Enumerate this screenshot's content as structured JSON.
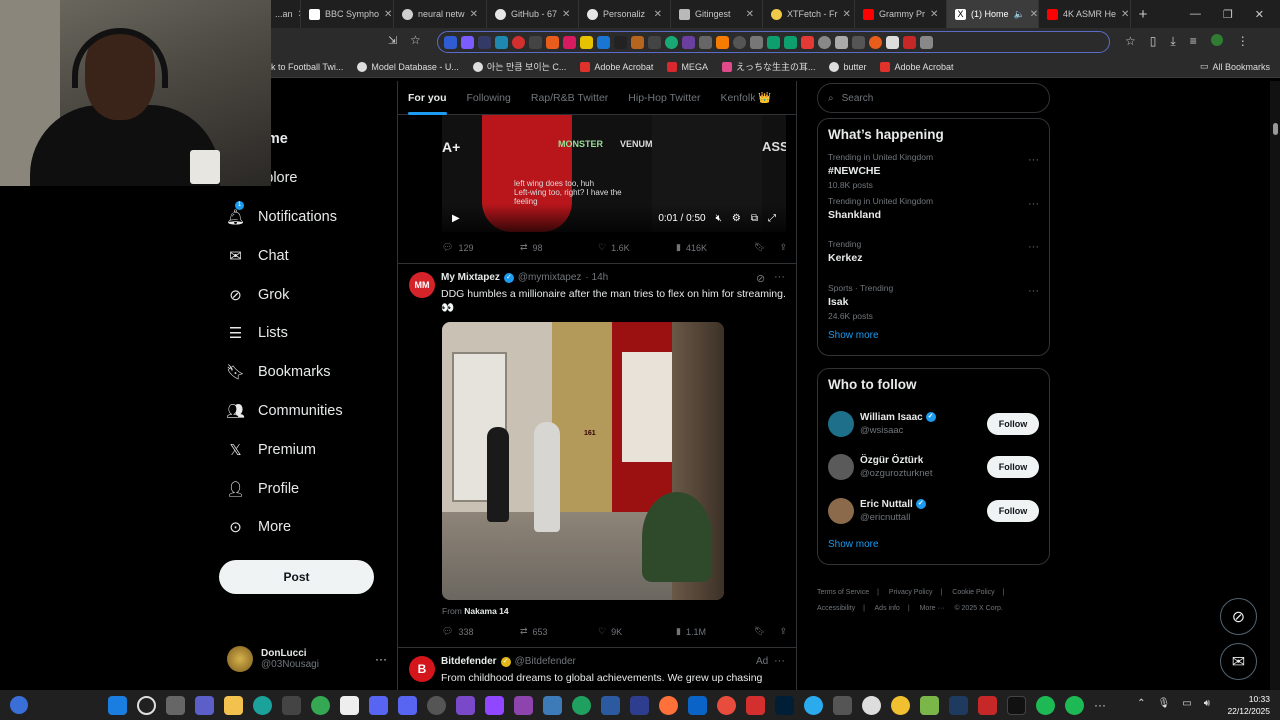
{
  "browser": {
    "tabs": [
      {
        "title": "...an",
        "color": "#888888",
        "active": false
      },
      {
        "title": "BBC Sympho",
        "color": "#ffffff",
        "active": false
      },
      {
        "title": "neural netw",
        "color": "#cfcfcf",
        "active": false
      },
      {
        "title": "GitHub - 67",
        "color": "#e6e6e6",
        "active": false
      },
      {
        "title": "Personaliz",
        "color": "#e6e6e6",
        "active": false
      },
      {
        "title": "Gitingest",
        "color": "#b9b9b9",
        "active": false
      },
      {
        "title": "XTFetch - Fr",
        "color": "#f0c94a",
        "active": false
      },
      {
        "title": "Grammy Pr",
        "color": "#ff0000",
        "active": false
      },
      {
        "title": "(1) Home",
        "color": "#ffffff",
        "active": true
      },
      {
        "title": "4K ASMR He",
        "color": "#ff0000",
        "active": false
      }
    ],
    "new_tab": "+",
    "window_controls": [
      "—",
      "❐",
      "✕"
    ],
    "bookmarks": [
      {
        "label": "k to Football Twi...",
        "color": "#1d9bf0"
      },
      {
        "label": "Model Database - U...",
        "color": "#dddddd"
      },
      {
        "label": "아는 만큼 보이는 C...",
        "color": "#dddddd"
      },
      {
        "label": "Adobe Acrobat",
        "color": "#e0322a"
      },
      {
        "label": "MEGA",
        "color": "#d9272e"
      },
      {
        "label": "えっちな生主の耳...",
        "color": "#e04a8a"
      },
      {
        "label": "butter",
        "color": "#dddddd"
      },
      {
        "label": "Adobe Acrobat",
        "color": "#e0322a"
      }
    ],
    "all_bookmarks": "All Bookmarks"
  },
  "nav": {
    "home": "ome",
    "explore": "xplore",
    "notifications": "Notifications",
    "notif_badge": "1",
    "chat": "Chat",
    "grok": "Grok",
    "lists": "Lists",
    "bookmarks": "Bookmarks",
    "communities": "Communities",
    "premium": "Premium",
    "profile": "Profile",
    "more": "More",
    "post": "Post"
  },
  "account": {
    "name": "DonLucci",
    "handle": "@03Nousagi"
  },
  "feed": {
    "tabs": [
      "For you",
      "Following",
      "Rap/R&B Twitter",
      "Hip-Hop Twitter",
      "Kenfolk 👑"
    ],
    "video": {
      "brands": [
        "A+",
        "MONSTER",
        "VENUM",
        "ASS"
      ],
      "subtitle1": "left wing does too, huh",
      "subtitle2": "Left-wing too, right?  I have the",
      "subtitle3": "feeling",
      "time": "0:01 / 0:50"
    },
    "tweet1_stats": {
      "replies": "129",
      "reposts": "98",
      "likes": "1.6K",
      "views": "416K"
    },
    "tweet2": {
      "name": "My Mixtapez",
      "handle": "@mymixtapez",
      "age": "· 14h",
      "text": "DDG humbles a millionaire after the man tries to flex on him for streaming. 👀",
      "media_number": "161",
      "from_label": "From",
      "from_source": "Nakama 14",
      "replies": "338",
      "reposts": "653",
      "likes": "9K",
      "views": "1.1M"
    },
    "tweet3": {
      "name": "Bitdefender",
      "handle": "@Bitdefender",
      "ad": "Ad",
      "text": "From childhood dreams to global achievements. We grew up chasing"
    }
  },
  "sidebar": {
    "search_placeholder": "Search",
    "happening_title": "What’s happening",
    "trends": [
      {
        "context": "Trending in United Kingdom",
        "title": "#NEWCHE",
        "count": "10.8K posts"
      },
      {
        "context": "Trending in United Kingdom",
        "title": "Shankland",
        "count": ""
      },
      {
        "context": "Trending",
        "title": "Kerkez",
        "count": ""
      },
      {
        "context": "Sports · Trending",
        "title": "Isak",
        "count": "24.6K posts"
      }
    ],
    "show_more": "Show more",
    "who_title": "Who to follow",
    "follow": [
      {
        "name": "William Isaac",
        "handle": "@wsisaac",
        "verified": true,
        "color": "#1e6f8a"
      },
      {
        "name": "Özgür Öztürk",
        "handle": "@ozgurozturknet",
        "verified": false,
        "color": "#5a5a5a"
      },
      {
        "name": "Eric Nuttall",
        "handle": "@ericnuttall",
        "verified": true,
        "color": "#8a6a4a"
      }
    ],
    "follow_label": "Follow",
    "show_more2": "Show more",
    "footer": [
      "Terms of Service",
      "|",
      "Privacy Policy",
      "|",
      "Cookie Policy",
      "|",
      "Accessibility",
      "|",
      "Ads info",
      "|",
      "More ···",
      "© 2025 X Corp."
    ]
  },
  "system": {
    "time": "10:33",
    "date": "22/12/2025"
  }
}
